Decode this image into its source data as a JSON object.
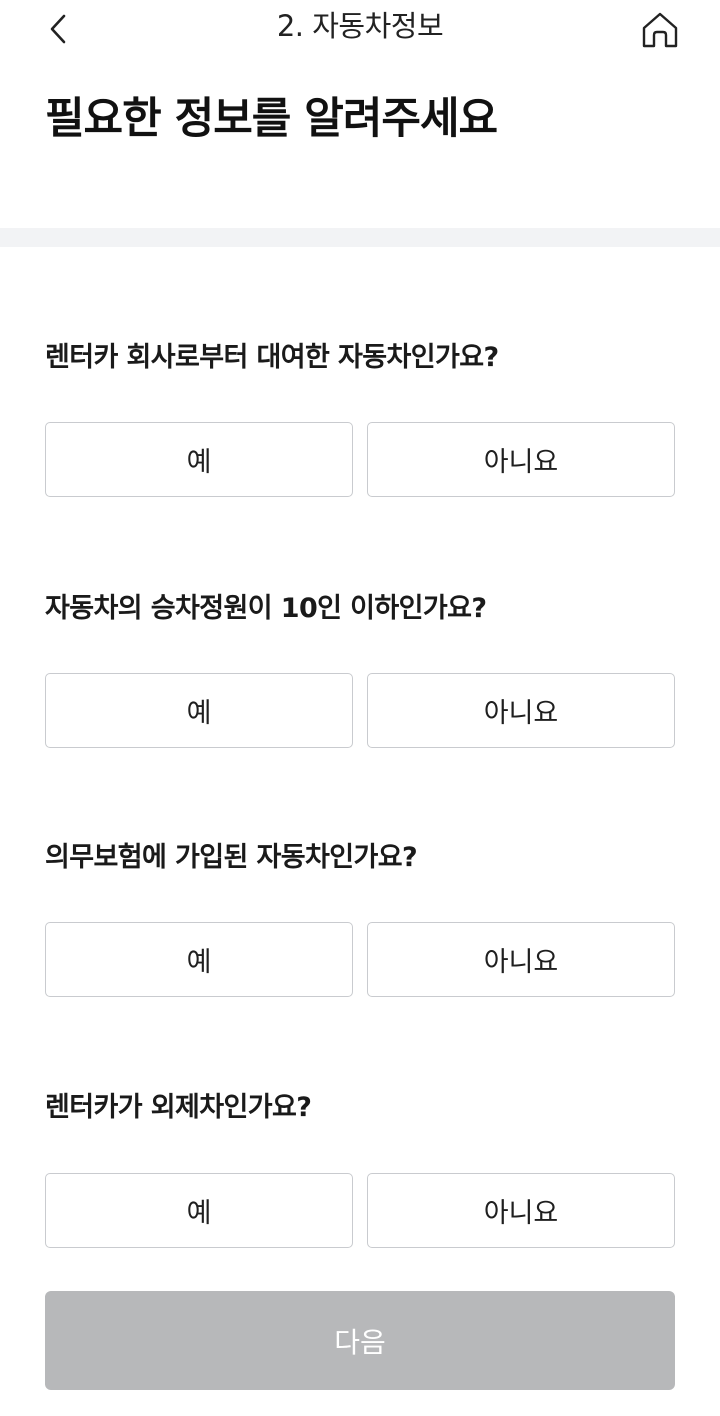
{
  "header": {
    "title": "2. 자동차정보",
    "back_icon": "chevron-left-icon",
    "home_icon": "home-icon"
  },
  "page_title": "필요한 정보를 알려주세요",
  "questions": [
    {
      "text": "렌터카 회사로부터 대여한 자동차인가요?",
      "yes_label": "예",
      "no_label": "아니요"
    },
    {
      "text": "자동차의 승차정원이 10인 이하인가요?",
      "yes_label": "예",
      "no_label": "아니요"
    },
    {
      "text": "의무보험에 가입된 자동차인가요?",
      "yes_label": "예",
      "no_label": "아니요"
    },
    {
      "text": "렌터카가 외제차인가요?",
      "yes_label": "예",
      "no_label": "아니요"
    }
  ],
  "next_button": {
    "label": "다음",
    "enabled": false
  },
  "colors": {
    "divider": "#f2f3f5",
    "option_border": "#c9cbcf",
    "next_disabled_bg": "#b7b8ba"
  }
}
